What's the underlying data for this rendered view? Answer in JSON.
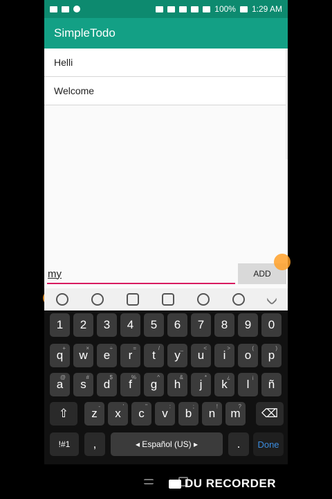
{
  "status": {
    "battery": "100%",
    "time": "1:29 AM"
  },
  "app": {
    "title": "SimpleTodo"
  },
  "todos": [
    "Helli",
    "Welcome"
  ],
  "input": {
    "value": "my"
  },
  "add_label": "ADD",
  "keyboard": {
    "numbers": [
      "1",
      "2",
      "3",
      "4",
      "5",
      "6",
      "7",
      "8",
      "9",
      "0"
    ],
    "row1": [
      "q",
      "w",
      "e",
      "r",
      "t",
      "y",
      "u",
      "i",
      "o",
      "p"
    ],
    "row1_sup": [
      "+",
      "×",
      "÷",
      "=",
      "/",
      "_",
      "<",
      ">",
      "(",
      ")"
    ],
    "row2": [
      "a",
      "s",
      "d",
      "f",
      "g",
      "h",
      "j",
      "k",
      "l",
      "ñ"
    ],
    "row2_sup": [
      "@",
      "#",
      "$",
      "%",
      "^",
      "&",
      "*",
      "¿",
      "¡",
      ""
    ],
    "row3": [
      "z",
      "x",
      "c",
      "v",
      "b",
      "n",
      "m"
    ],
    "row3_sup": [
      "-",
      "'",
      "\"",
      ":",
      ";",
      "!",
      "?"
    ],
    "symbols_label": "!#1",
    "comma_label": ",",
    "space_label": "◂ Español (US) ▸",
    "period_label": ".",
    "done_label": "Done"
  },
  "watermark": "DU RECORDER",
  "colors": {
    "status_bar": "#0d8a6f",
    "app_bar": "#13a085",
    "input_underline": "#d81b60",
    "done": "#3b8de0"
  }
}
